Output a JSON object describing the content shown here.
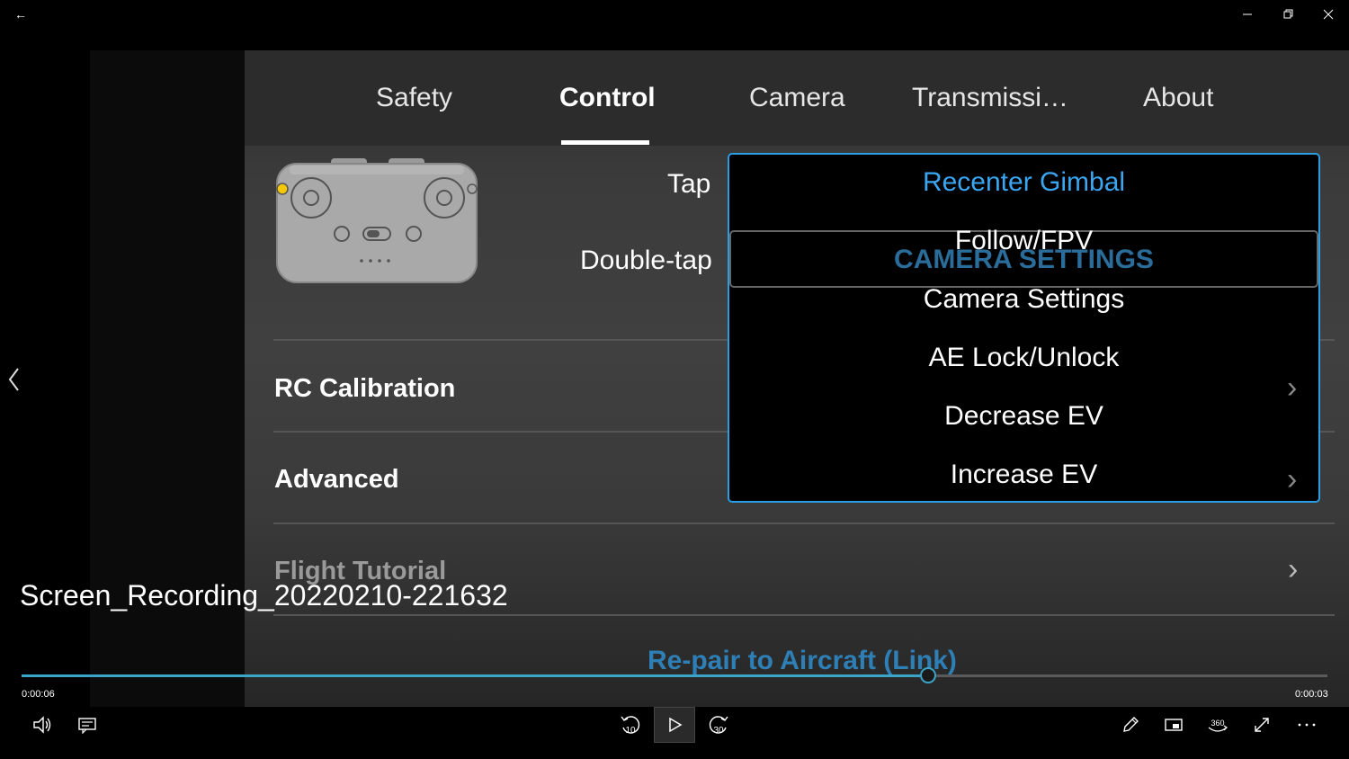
{
  "titlebar": {
    "back": "←",
    "minimize": "—",
    "restore": "❐",
    "close": "✕"
  },
  "tabs": [
    {
      "label": "Safety",
      "active": false
    },
    {
      "label": "Control",
      "active": true
    },
    {
      "label": "Camera",
      "active": false
    },
    {
      "label": "Transmissi…",
      "active": false
    },
    {
      "label": "About",
      "active": false
    }
  ],
  "button_mapping": {
    "tap_label": "Tap",
    "double_tap_label": "Double-tap"
  },
  "rows": [
    {
      "label": "RC Calibration"
    },
    {
      "label": "Advanced"
    },
    {
      "label": "Flight Tutorial"
    }
  ],
  "repair_link": "Re-pair to Aircraft (Link)",
  "dropdown": {
    "ghost_label": "CAMERA SETTINGS",
    "options": [
      {
        "label": "Recenter Gimbal",
        "highlighted": true
      },
      {
        "label": "Follow/FPV",
        "highlighted": false
      },
      {
        "label": "Camera Settings",
        "highlighted": false
      },
      {
        "label": "AE Lock/Unlock",
        "highlighted": false
      },
      {
        "label": "Decrease EV",
        "highlighted": false
      },
      {
        "label": "Increase EV",
        "highlighted": false
      }
    ]
  },
  "player": {
    "title": "Screen_Recording_20220210-221632",
    "elapsed": "0:00:06",
    "remaining": "0:00:03",
    "progress": 0.694,
    "skip_back": "10",
    "skip_forward": "30",
    "badge_360": "360"
  },
  "colors": {
    "accent": "#2a9de3",
    "seek": "#3aa5c8",
    "link": "#2d7fb6",
    "highlight": "#3aa5f0"
  }
}
